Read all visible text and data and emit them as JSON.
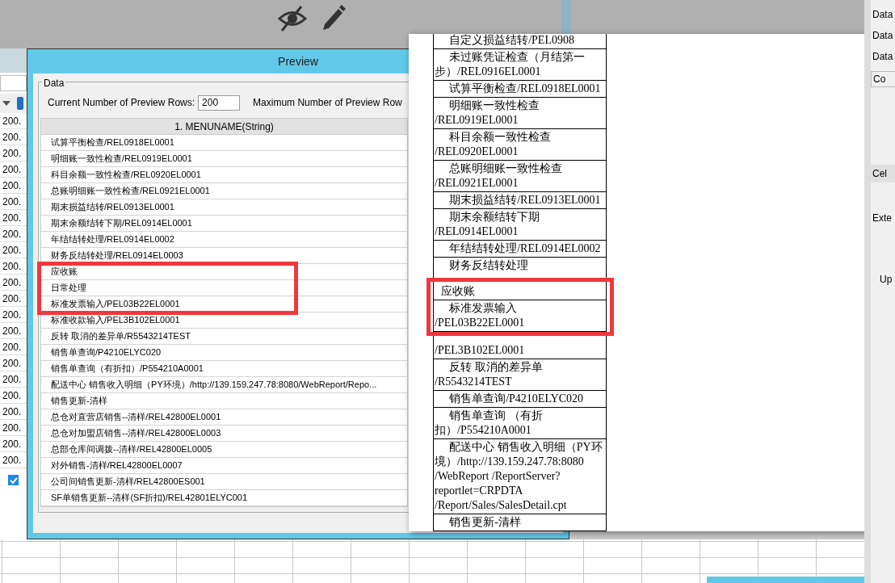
{
  "side_panel": {
    "rows": [
      "200.",
      "200.",
      "200.",
      "200.",
      "200.",
      "200.",
      "200.",
      "200.",
      "200.",
      "200.",
      "200.",
      "200.",
      "200.",
      "200.",
      "200.",
      "200.",
      "200.",
      "200.",
      "200.",
      "200.",
      "200.",
      "200."
    ],
    "checkbox": {
      "checked": true
    }
  },
  "preview_dialog": {
    "title": "Preview",
    "group_title": "Data",
    "current_rows_label": "Current Number of  Preview Rows:",
    "current_rows_value": "200",
    "max_rows_label": "Maximum Number of Preview Row",
    "column": "1. MENUNAME(String)",
    "rows": [
      {
        "text": "试算平衡检查/REL0918EL0001",
        "highlighted": false
      },
      {
        "text": "明细账一致性检查/REL0919EL0001",
        "highlighted": false
      },
      {
        "text": "科目余额一致性检查/REL0920EL0001",
        "highlighted": false
      },
      {
        "text": "总账明细账一致性检查/REL0921EL0001",
        "highlighted": false
      },
      {
        "text": "期末损益结转/REL0913EL0001",
        "highlighted": false
      },
      {
        "text": "期末余额结转下期/REL0914EL0001",
        "highlighted": false
      },
      {
        "text": "年结结转处理/REL0914EL0002",
        "highlighted": false
      },
      {
        "text": "财务反结转处理/REL0914EL0003",
        "highlighted": false
      },
      {
        "text": "应收账",
        "highlighted": true
      },
      {
        "text": "日常处理",
        "highlighted": true
      },
      {
        "text": "标准发票输入/PEL03B22EL0001",
        "highlighted": true
      },
      {
        "text": "标准收款输入/PEL3B102EL0001",
        "highlighted": false
      },
      {
        "text": "反转 取消的差异单/R5543214TEST",
        "highlighted": false
      },
      {
        "text": "销售单查询/P4210ELYC020",
        "highlighted": false
      },
      {
        "text": "销售单查询（有折扣）/P554210A0001",
        "highlighted": false
      },
      {
        "text": "配送中心 销售收入明细（PY环境）/http://139.159.247.78:8080/WebReport/Repo...",
        "highlighted": false
      },
      {
        "text": "销售更新-清样",
        "highlighted": false
      },
      {
        "text": "总仓对直营店销售--清样/REL42800EL0001",
        "highlighted": false
      },
      {
        "text": "总仓对加盟店销售--清样/REL42800EL0003",
        "highlighted": false
      },
      {
        "text": "总部仓库间调拨--清样/REL42800EL0005",
        "highlighted": false
      },
      {
        "text": "对外销售-清样/REL42800EL0007",
        "highlighted": false
      },
      {
        "text": "公司间销售更新-清样/REL42800ES001",
        "highlighted": false
      },
      {
        "text": "SF单销售更新--清样(SF折扣)/REL42801ELYC001",
        "highlighted": false
      }
    ]
  },
  "report_page": {
    "rows": [
      {
        "text": "自定义损益结转/PEL0908",
        "kind": "item",
        "highlighted": false
      },
      {
        "text": "未过账凭证检查（月结第一步）/REL0916EL0001",
        "kind": "item",
        "highlighted": false
      },
      {
        "text": "试算平衡检查/REL0918EL0001",
        "kind": "item",
        "highlighted": false
      },
      {
        "text": "明细账一致性检查 /REL0919EL0001",
        "kind": "item",
        "highlighted": false
      },
      {
        "text": "科目余额一致性检查 /REL0920EL0001",
        "kind": "item",
        "highlighted": false
      },
      {
        "text": "总账明细账一致性检查 /REL0921EL0001",
        "kind": "item",
        "highlighted": false
      },
      {
        "text": "期末损益结转/REL0913EL0001",
        "kind": "item",
        "highlighted": false
      },
      {
        "text": "期末余额结转下期 /REL0914EL0001",
        "kind": "item",
        "highlighted": false
      },
      {
        "text": "年结结转处理/REL0914EL0002",
        "kind": "item",
        "highlighted": false
      },
      {
        "text": "财务反结转处理",
        "kind": "head",
        "highlighted": false
      },
      {
        "text": "应收账",
        "kind": "heading",
        "highlighted": true
      },
      {
        "text": "标准发票输入 /PEL03B22EL0001",
        "kind": "item",
        "highlighted": true
      },
      {
        "text": "/PEL3B102EL0001",
        "kind": "tail",
        "highlighted": false
      },
      {
        "text": "反转 取消的差异单 /R5543214TEST",
        "kind": "item",
        "highlighted": false
      },
      {
        "text": "销售单查询/P4210ELYC020",
        "kind": "item",
        "highlighted": false
      },
      {
        "text": "销售单查询 （有折扣）/P554210A0001",
        "kind": "item",
        "highlighted": false
      },
      {
        "text": "配送中心 销售收入明细（PY环境）/http://139.159.247.78:8080 /WebReport /ReportServer?reportlet=CRPDTA /Report/Sales/SalesDetail.cpt",
        "kind": "item",
        "highlighted": false
      },
      {
        "text": "销售更新-清样",
        "kind": "item",
        "highlighted": false
      }
    ]
  },
  "right_panel": {
    "labels": [
      "Data",
      "Data",
      "Data",
      "Co",
      "Cel",
      "Exte",
      "Up"
    ]
  }
}
